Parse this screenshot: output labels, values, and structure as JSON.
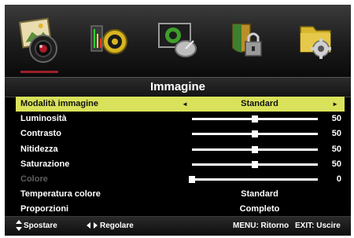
{
  "menu_icons": [
    {
      "name": "picture-icon",
      "active": true
    },
    {
      "name": "sound-icon",
      "active": false
    },
    {
      "name": "channel-icon",
      "active": false
    },
    {
      "name": "lock-icon",
      "active": false
    },
    {
      "name": "setup-icon",
      "active": false
    }
  ],
  "title": "Immagine",
  "rows": {
    "mode": {
      "label": "Modalità immagine",
      "value": "Standard",
      "left_arrow": "◄",
      "right_arrow": "►"
    },
    "brightness": {
      "label": "Luminosità",
      "value": "50"
    },
    "contrast": {
      "label": "Contrasto",
      "value": "50"
    },
    "sharpness": {
      "label": "Nitidezza",
      "value": "50"
    },
    "saturation": {
      "label": "Saturazione",
      "value": "50"
    },
    "color": {
      "label": "Colore",
      "value": "0"
    },
    "color_temp": {
      "label": "Temperatura colore",
      "value": "Standard"
    },
    "aspect": {
      "label": "Proporzioni",
      "value": "Completo"
    }
  },
  "footer": {
    "move": "Spostare",
    "adjust": "Regolare",
    "menu": "MENU: Ritorno",
    "exit": "EXIT: Uscire"
  },
  "colors": {
    "highlight": "#d9e25a",
    "active_tab_underline": "#9c1f2a",
    "disabled_text": "#5f5f5f"
  }
}
